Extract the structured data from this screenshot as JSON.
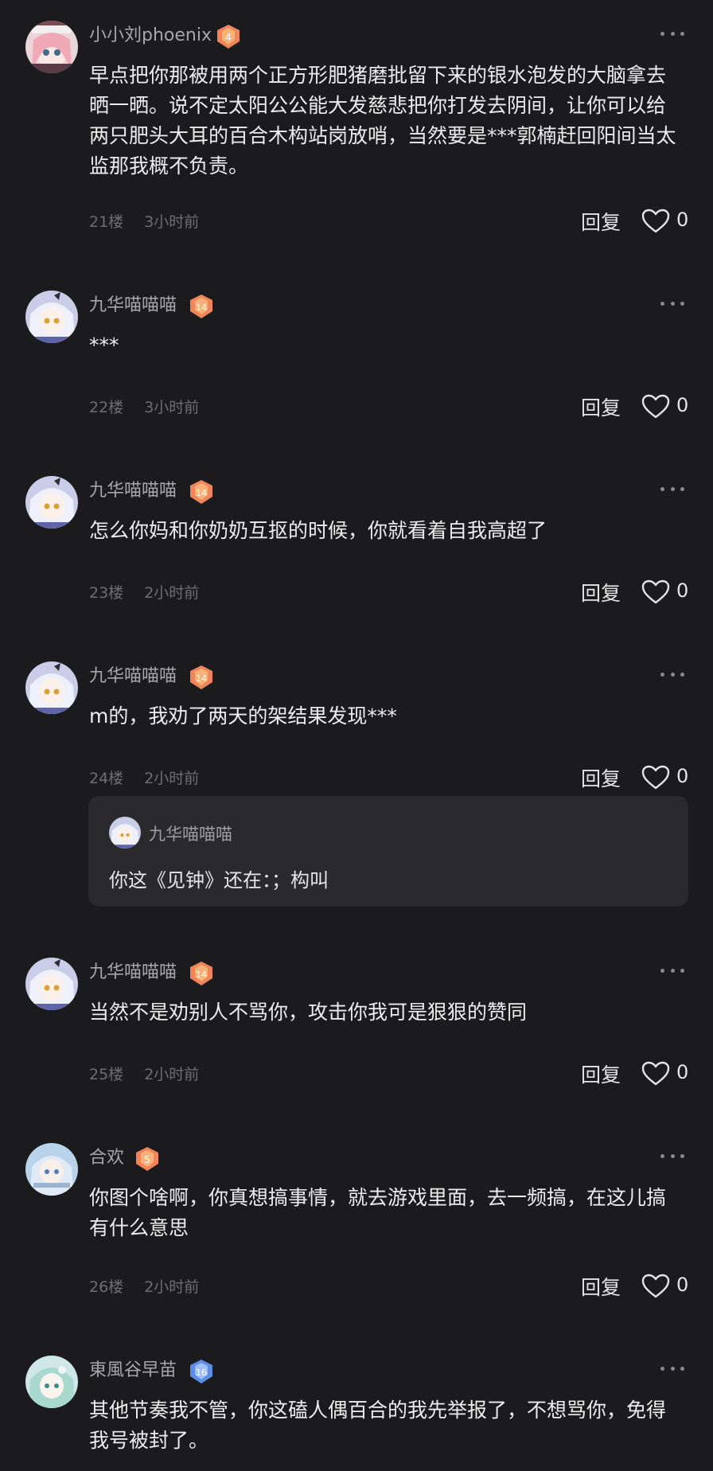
{
  "colors": {
    "background": "#1b1b1d",
    "username": "#a7a7ab",
    "content": "#ececec",
    "meta": "#6e6e72",
    "reply_box_bg": "#2a2a2d",
    "badge_orange": "#f0855a",
    "badge_blue": "#5b8de6"
  },
  "comments": [
    {
      "username": "小小刘phoenix",
      "level": "4",
      "badge_color": "orange",
      "avatar_icon": "pink-hair-girl-avatar",
      "content": "早点把你那被用两个正方形肥猪磨批留下来的银水泡发的大脑拿去晒一晒。说不定太阳公公能大发慈悲把你打发去阴间，让你可以给两只肥头大耳的百合木构站岗放哨，当然要是***郭楠赶回阳间当太监那我概不负责。",
      "floor": "21楼",
      "time": "3小时前",
      "reply_label": "回复",
      "likes": "0"
    },
    {
      "username": "九华喵喵喵",
      "level": "14",
      "badge_color": "orange",
      "avatar_icon": "white-hair-girl-avatar",
      "content": "***",
      "floor": "22楼",
      "time": "3小时前",
      "reply_label": "回复",
      "likes": "0"
    },
    {
      "username": "九华喵喵喵",
      "level": "14",
      "badge_color": "orange",
      "avatar_icon": "white-hair-girl-avatar",
      "content": "怎么你妈和你奶奶互抠的时候，你就看着自我高超了",
      "floor": "23楼",
      "time": "2小时前",
      "reply_label": "回复",
      "likes": "0"
    },
    {
      "username": "九华喵喵喵",
      "level": "14",
      "badge_color": "orange",
      "avatar_icon": "white-hair-girl-avatar",
      "content": "m的，我劝了两天的架结果发现***",
      "floor": "24楼",
      "time": "2小时前",
      "reply_label": "回复",
      "likes": "0",
      "sub_reply": {
        "username": "九华喵喵喵",
        "text": "你这《见钟》还在：；构叫"
      }
    },
    {
      "username": "九华喵喵喵",
      "level": "14",
      "badge_color": "orange",
      "avatar_icon": "white-hair-girl-avatar",
      "content": "当然不是劝别人不骂你，攻击你我可是狠狠的赞同",
      "floor": "25楼",
      "time": "2小时前",
      "reply_label": "回复",
      "likes": "0"
    },
    {
      "username": "合欢",
      "level": "5",
      "badge_color": "orange",
      "avatar_icon": "blue-hair-girl-avatar",
      "content": "你图个啥啊，你真想搞事情，就去游戏里面，去一频搞，在这儿搞有什么意思",
      "floor": "26楼",
      "time": "2小时前",
      "reply_label": "回复",
      "likes": "0"
    },
    {
      "username": "東風谷早苗",
      "level": "16",
      "badge_color": "blue",
      "avatar_icon": "teal-hair-girl-avatar",
      "content": "其他节奏我不管，你这磕人偶百合的我先举报了，不想骂你，免得我号被封了。"
    }
  ]
}
